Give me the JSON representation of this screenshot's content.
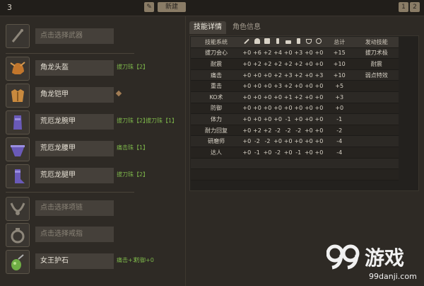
{
  "header": {
    "set_number": "3",
    "edit_label": "✎",
    "new_label": "新建",
    "pages": [
      "1",
      "2"
    ]
  },
  "equipment": [
    {
      "name": "点击选择武器",
      "placeholder": true,
      "decorations": []
    },
    {
      "name": "角龙头盔",
      "placeholder": false,
      "decorations": [
        "拔刀珠【2】"
      ]
    },
    {
      "name": "角龙铠甲",
      "placeholder": false,
      "decorations": []
    },
    {
      "name": "荒厄龙腕甲",
      "placeholder": false,
      "decorations": [
        "拔刀珠【2】",
        "拔刀珠【1】"
      ]
    },
    {
      "name": "荒厄龙腰甲",
      "placeholder": false,
      "decorations": [
        "痛击珠【1】"
      ]
    },
    {
      "name": "荒厄龙腿甲",
      "placeholder": false,
      "decorations": [
        "拔刀珠【2】"
      ]
    },
    {
      "name": "点击选择项链",
      "placeholder": true,
      "decorations": []
    },
    {
      "name": "点击选择戒指",
      "placeholder": true,
      "decorations": []
    },
    {
      "name": "女王护石",
      "placeholder": false,
      "decorations": [
        "痛击+3",
        "防御+0"
      ]
    }
  ],
  "tabs": {
    "skill_details": "技能详情",
    "char_info": "角色信息"
  },
  "skill_table": {
    "col_system": "技能系统",
    "col_total": "总计",
    "col_active": "发动技能",
    "header_icons": [
      "weapon-icon",
      "helmet-icon",
      "chest-icon",
      "arm-icon",
      "waist-icon",
      "leg-icon",
      "necklace-icon",
      "ring-icon"
    ],
    "rows": [
      {
        "name": "拔刀会心",
        "pts": [
          "+0",
          "+6",
          "+2",
          "+4",
          "+0",
          "+3",
          "+0",
          "+0"
        ],
        "total": "+15",
        "active": "拔刀术极"
      },
      {
        "name": "耐震",
        "pts": [
          "+0",
          "+2",
          "+2",
          "+2",
          "+2",
          "+2",
          "+0",
          "+0"
        ],
        "total": "+10",
        "active": "耐震"
      },
      {
        "name": "痛击",
        "pts": [
          "+0",
          "+0",
          "+0",
          "+2",
          "+3",
          "+2",
          "+0",
          "+3"
        ],
        "total": "+10",
        "active": "弱点特效"
      },
      {
        "name": "重击",
        "pts": [
          "+0",
          "+0",
          "+0",
          "+3",
          "+2",
          "+0",
          "+0",
          "+0"
        ],
        "total": "+5",
        "active": ""
      },
      {
        "name": "KO术",
        "pts": [
          "+0",
          "+0",
          "+0",
          "+0",
          "+1",
          "+2",
          "+0",
          "+0"
        ],
        "total": "+3",
        "active": ""
      },
      {
        "name": "防御",
        "pts": [
          "+0",
          "+0",
          "+0",
          "+0",
          "+0",
          "+0",
          "+0",
          "+0"
        ],
        "total": "+0",
        "active": ""
      },
      {
        "name": "体力",
        "pts": [
          "+0",
          "+0",
          "+0",
          "+0",
          "-1",
          "+0",
          "+0",
          "+0"
        ],
        "total": "-1",
        "active": ""
      },
      {
        "name": "耐力回复",
        "pts": [
          "+0",
          "+2",
          "+2",
          "-2",
          "-2",
          "-2",
          "+0",
          "+0"
        ],
        "total": "-2",
        "active": ""
      },
      {
        "name": "研磨师",
        "pts": [
          "+0",
          "-2",
          "-2",
          "+0",
          "+0",
          "+0",
          "+0",
          "+0"
        ],
        "total": "-4",
        "active": ""
      },
      {
        "name": "达人",
        "pts": [
          "+0",
          "-1",
          "+0",
          "-2",
          "+0",
          "-1",
          "+0",
          "+0"
        ],
        "total": "-4",
        "active": ""
      }
    ]
  },
  "watermark": {
    "brand": "游戏",
    "domain": "99danji.com"
  },
  "colors": {
    "bg": "#2e2a25",
    "accent_green": "#7db64a",
    "panel": "#23211e"
  }
}
